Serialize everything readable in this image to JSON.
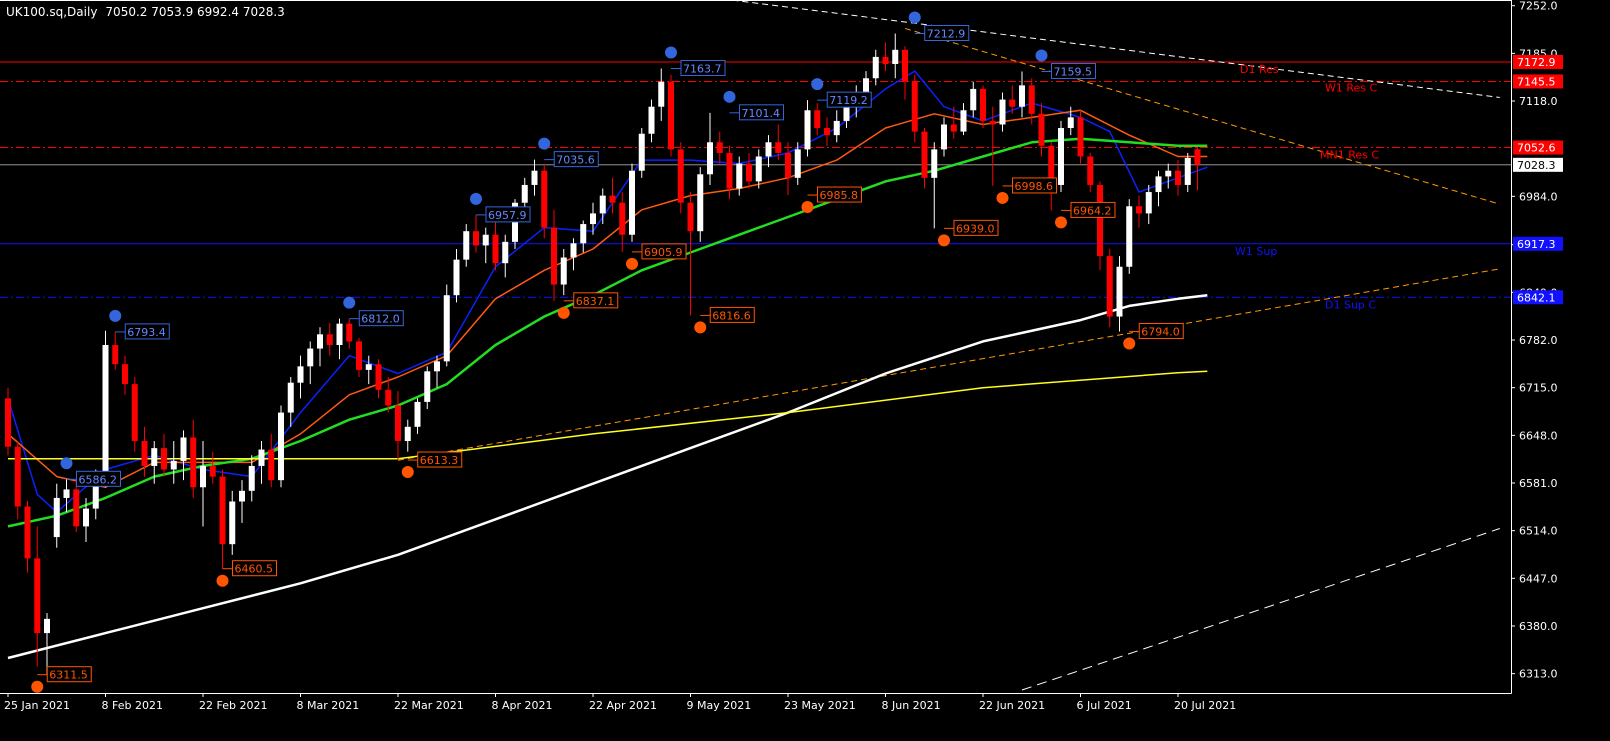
{
  "header": {
    "symbol_tf": "UK100.sq,Daily",
    "ohlc": "7050.2 7053.9 6992.4 7028.3"
  },
  "colors": {
    "background": "#000000",
    "axis": "#ffffff",
    "bull": "#ffffff",
    "bear": "#ff0000",
    "ema_blue": "#0a22ff",
    "ema_orange": "#ff5a14",
    "ema_green": "#22dd22",
    "sma_white": "#ffffff",
    "sma_yellow": "#ffff22",
    "swing_high": "#3366dd",
    "swing_low": "#ff5500",
    "res_red": "#ff0000",
    "sup_blue": "#1111ff",
    "trend_orange": "#ff9900"
  },
  "chart_data": {
    "type": "candlestick",
    "title": "UK100.sq,Daily",
    "ylim": [
      6290,
      7260
    ],
    "y_ticks": [
      7252.0,
      7185.0,
      7118.0,
      6984.0,
      6916.0,
      6849.0,
      6782.0,
      6715.0,
      6648.0,
      6581.0,
      6514.0,
      6447.0,
      6380.0,
      6313.0
    ],
    "x_labels": [
      "25 Jan 2021",
      "8 Feb 2021",
      "22 Feb 2021",
      "8 Mar 2021",
      "22 Mar 2021",
      "8 Apr 2021",
      "22 Apr 2021",
      "9 May 2021",
      "23 May 2021",
      "8 Jun 2021",
      "22 Jun 2021",
      "6 Jul 2021",
      "20 Jul 2021"
    ],
    "x_label_index": [
      0,
      10,
      20,
      30,
      40,
      50,
      60,
      70,
      80,
      90,
      100,
      110,
      120
    ],
    "last_price": 7028.3,
    "price_tags": [
      {
        "value": 7172.9,
        "color": "#ff0000"
      },
      {
        "value": 7145.5,
        "color": "#ff0000"
      },
      {
        "value": 7052.6,
        "color": "#ff0000"
      },
      {
        "value": 6917.3,
        "color": "#1111ff"
      },
      {
        "value": 6842.1,
        "color": "#1111ff"
      }
    ],
    "levels": [
      {
        "name": "D1 Res",
        "value": 7172.9,
        "style": "solid",
        "color": "#ff0000"
      },
      {
        "name": "W1 Res C",
        "value": 7145.5,
        "style": "dashdot",
        "color": "#ff0000"
      },
      {
        "name": "MN1 Res C",
        "value": 7052.6,
        "style": "dashdot",
        "color": "#ff0000"
      },
      {
        "name": "W1 Sup",
        "value": 6917.3,
        "style": "solid",
        "color": "#1111ff"
      },
      {
        "name": "D1 Sup C",
        "value": 6842.1,
        "style": "dashdot",
        "color": "#1111ff"
      }
    ],
    "level_labels": [
      {
        "text": "D1 Res",
        "value": 7172.9
      },
      {
        "text": "W1 Res C",
        "value": 7145.5
      },
      {
        "text": "MN1 Res C",
        "value": 7052.6
      },
      {
        "text": "W1 Sup",
        "value": 6917.3
      },
      {
        "text": "D1 Sup C",
        "value": 6842.1
      }
    ],
    "swing_highs": [
      {
        "i": 11,
        "value": 6793.4,
        "text": "6793.4"
      },
      {
        "i": 6,
        "value": 6586.2,
        "text": "6586.2"
      },
      {
        "i": 35,
        "value": 6812.0,
        "text": "6812.0"
      },
      {
        "i": 48,
        "value": 6957.9,
        "text": "6957.9"
      },
      {
        "i": 55,
        "value": 7035.6,
        "text": "7035.6"
      },
      {
        "i": 68,
        "value": 7163.7,
        "text": "7163.7"
      },
      {
        "i": 74,
        "value": 7101.4,
        "text": "7101.4"
      },
      {
        "i": 83,
        "value": 7119.2,
        "text": "7119.2"
      },
      {
        "i": 93,
        "value": 7212.9,
        "text": "7212.9"
      },
      {
        "i": 106,
        "value": 7159.5,
        "text": "7159.5"
      }
    ],
    "swing_lows": [
      {
        "i": 3,
        "value": 6311.5,
        "text": "6311.5"
      },
      {
        "i": 22,
        "value": 6460.5,
        "text": "6460.5"
      },
      {
        "i": 41,
        "value": 6613.3,
        "text": "6613.3"
      },
      {
        "i": 57,
        "value": 6837.1,
        "text": "6837.1"
      },
      {
        "i": 64,
        "value": 6905.9,
        "text": "6905.9"
      },
      {
        "i": 71,
        "value": 6816.6,
        "text": "6816.6"
      },
      {
        "i": 82,
        "value": 6985.8,
        "text": "6985.8"
      },
      {
        "i": 96,
        "value": 6939.0,
        "text": "6939.0"
      },
      {
        "i": 102,
        "value": 6998.6,
        "text": "6998.6"
      },
      {
        "i": 108,
        "value": 6964.2,
        "text": "6964.2"
      },
      {
        "i": 115,
        "value": 6794.0,
        "text": "6794.0"
      }
    ],
    "trendlines": [
      {
        "color": "#ffffff",
        "dash": "6,4",
        "i1": 57,
        "v1": 7290,
        "i2": 153,
        "v2": 7123
      },
      {
        "color": "#ff9900",
        "dash": "6,4",
        "i1": 92,
        "v1": 7220,
        "i2": 153,
        "v2": 6973
      },
      {
        "color": "#ff9900",
        "dash": "6,4",
        "i1": 40,
        "v1": 6613,
        "i2": 153,
        "v2": 6882
      },
      {
        "color": "#ffffff",
        "dash": "10,6",
        "i1": 104,
        "v1": 6290,
        "i2": 153,
        "v2": 6517
      }
    ],
    "ohlc": [
      [
        6700,
        6715,
        6620,
        6632
      ],
      [
        6632,
        6640,
        6530,
        6548
      ],
      [
        6548,
        6556,
        6455,
        6475
      ],
      [
        6475,
        6520,
        6323,
        6370
      ],
      [
        6370,
        6398,
        6311.5,
        6390
      ],
      [
        6505,
        6580,
        6490,
        6560
      ],
      [
        6560,
        6586.2,
        6540,
        6572
      ],
      [
        6572,
        6585,
        6512,
        6520
      ],
      [
        6520,
        6560,
        6498,
        6545
      ],
      [
        6545,
        6600,
        6530,
        6585
      ],
      [
        6585,
        6795,
        6575,
        6775
      ],
      [
        6775,
        6793.4,
        6740,
        6748
      ],
      [
        6748,
        6760,
        6705,
        6720
      ],
      [
        6720,
        6730,
        6625,
        6640
      ],
      [
        6640,
        6660,
        6590,
        6605
      ],
      [
        6605,
        6640,
        6580,
        6630
      ],
      [
        6630,
        6650,
        6590,
        6600
      ],
      [
        6600,
        6640,
        6580,
        6612
      ],
      [
        6612,
        6655,
        6585,
        6645
      ],
      [
        6645,
        6670,
        6560,
        6575
      ],
      [
        6575,
        6640,
        6520,
        6605
      ],
      [
        6605,
        6625,
        6580,
        6590
      ],
      [
        6590,
        6600,
        6460.5,
        6495
      ],
      [
        6495,
        6570,
        6480,
        6555
      ],
      [
        6555,
        6585,
        6525,
        6570
      ],
      [
        6570,
        6620,
        6555,
        6605
      ],
      [
        6605,
        6640,
        6580,
        6628
      ],
      [
        6628,
        6650,
        6575,
        6585
      ],
      [
        6585,
        6690,
        6575,
        6680
      ],
      [
        6680,
        6730,
        6660,
        6722
      ],
      [
        6722,
        6760,
        6700,
        6745
      ],
      [
        6745,
        6780,
        6720,
        6770
      ],
      [
        6770,
        6800,
        6745,
        6790
      ],
      [
        6790,
        6806,
        6760,
        6775
      ],
      [
        6775,
        6812,
        6755,
        6805
      ],
      [
        6805,
        6812,
        6770,
        6780
      ],
      [
        6780,
        6785,
        6730,
        6740
      ],
      [
        6740,
        6760,
        6720,
        6748
      ],
      [
        6748,
        6755,
        6700,
        6712
      ],
      [
        6712,
        6730,
        6680,
        6690
      ],
      [
        6690,
        6710,
        6613.3,
        6640
      ],
      [
        6640,
        6670,
        6625,
        6660
      ],
      [
        6660,
        6700,
        6650,
        6695
      ],
      [
        6695,
        6745,
        6685,
        6738
      ],
      [
        6738,
        6760,
        6715,
        6752
      ],
      [
        6752,
        6860,
        6745,
        6845
      ],
      [
        6845,
        6910,
        6835,
        6895
      ],
      [
        6895,
        6945,
        6885,
        6935
      ],
      [
        6935,
        6957.9,
        6905,
        6915
      ],
      [
        6915,
        6940,
        6890,
        6930
      ],
      [
        6930,
        6950,
        6880,
        6890
      ],
      [
        6890,
        6930,
        6870,
        6920
      ],
      [
        6920,
        6980,
        6910,
        6975
      ],
      [
        6975,
        7010,
        6960,
        7000
      ],
      [
        7000,
        7035.6,
        6985,
        7020
      ],
      [
        7020,
        7030,
        6925,
        6940
      ],
      [
        6940,
        6965,
        6837.1,
        6860
      ],
      [
        6860,
        6910,
        6845,
        6898
      ],
      [
        6898,
        6925,
        6880,
        6918
      ],
      [
        6918,
        6950,
        6905,
        6945
      ],
      [
        6945,
        6975,
        6930,
        6960
      ],
      [
        6960,
        6995,
        6945,
        6985
      ],
      [
        6985,
        7010,
        6960,
        6975
      ],
      [
        6975,
        6990,
        6905.9,
        6930
      ],
      [
        6930,
        7030,
        6920,
        7020
      ],
      [
        7020,
        7080,
        7010,
        7072
      ],
      [
        7072,
        7120,
        7060,
        7110
      ],
      [
        7110,
        7163.7,
        7090,
        7145
      ],
      [
        7145,
        7155,
        7040,
        7050
      ],
      [
        7050,
        7060,
        6960,
        6975
      ],
      [
        6975,
        6990,
        6816.6,
        6935
      ],
      [
        6935,
        7025,
        6920,
        7015
      ],
      [
        7015,
        7101.4,
        7000,
        7060
      ],
      [
        7060,
        7075,
        7030,
        7045
      ],
      [
        7045,
        7055,
        6980,
        6995
      ],
      [
        6995,
        7040,
        6985,
        7030
      ],
      [
        7030,
        7045,
        6995,
        7005
      ],
      [
        7005,
        7050,
        6995,
        7040
      ],
      [
        7040,
        7070,
        7025,
        7060
      ],
      [
        7060,
        7085,
        7035,
        7045
      ],
      [
        7045,
        7060,
        6985.8,
        7010
      ],
      [
        7010,
        7060,
        7000,
        7050
      ],
      [
        7050,
        7119.2,
        7040,
        7105
      ],
      [
        7105,
        7115,
        7070,
        7080
      ],
      [
        7080,
        7095,
        7055,
        7070
      ],
      [
        7070,
        7105,
        7060,
        7090
      ],
      [
        7090,
        7120,
        7080,
        7110
      ],
      [
        7110,
        7140,
        7095,
        7130
      ],
      [
        7130,
        7160,
        7115,
        7150
      ],
      [
        7150,
        7190,
        7140,
        7180
      ],
      [
        7180,
        7200,
        7160,
        7170
      ],
      [
        7170,
        7212.9,
        7150,
        7190
      ],
      [
        7190,
        7195,
        7120,
        7145
      ],
      [
        7145,
        7155,
        7060,
        7075
      ],
      [
        7075,
        7080,
        6995,
        7010
      ],
      [
        7010,
        7060,
        6939,
        7050
      ],
      [
        7050,
        7095,
        7040,
        7085
      ],
      [
        7085,
        7110,
        7065,
        7075
      ],
      [
        7075,
        7115,
        7070,
        7105
      ],
      [
        7105,
        7145,
        7095,
        7135
      ],
      [
        7135,
        7140,
        7080,
        7090
      ],
      [
        7090,
        7110,
        6998.6,
        7085
      ],
      [
        7085,
        7130,
        7075,
        7120
      ],
      [
        7120,
        7140,
        7100,
        7110
      ],
      [
        7110,
        7159.5,
        7095,
        7140
      ],
      [
        7140,
        7150,
        7085,
        7100
      ],
      [
        7100,
        7115,
        7040,
        7055
      ],
      [
        7055,
        7060,
        6964.2,
        7000
      ],
      [
        7000,
        7090,
        6990,
        7080
      ],
      [
        7080,
        7110,
        7070,
        7095
      ],
      [
        7095,
        7105,
        7030,
        7040
      ],
      [
        7040,
        7045,
        6990,
        7000
      ],
      [
        7000,
        7005,
        6880,
        6900
      ],
      [
        6900,
        6910,
        6800,
        6815
      ],
      [
        6815,
        6900,
        6794,
        6885
      ],
      [
        6885,
        6980,
        6875,
        6970
      ],
      [
        6970,
        6985,
        6940,
        6960
      ],
      [
        6960,
        7000,
        6945,
        6990
      ],
      [
        6990,
        7020,
        6970,
        7012
      ],
      [
        7012,
        7030,
        6995,
        7020
      ],
      [
        7020,
        7035,
        6985,
        7000
      ],
      [
        7000,
        7045,
        6990,
        7038
      ],
      [
        7050.2,
        7053.9,
        6992.4,
        7028.3
      ]
    ],
    "series": [
      {
        "name": "EMA fast",
        "color": "#0a22ff",
        "width": 1.5
      },
      {
        "name": "EMA mid",
        "color": "#ff5a14",
        "width": 1.5
      },
      {
        "name": "EMA slow",
        "color": "#22dd22",
        "width": 2.5
      },
      {
        "name": "SMA long",
        "color": "#ffffff",
        "width": 2.5
      },
      {
        "name": "SMA base",
        "color": "#ffff22",
        "width": 1.5
      }
    ],
    "ma_points": {
      "EMA fast": [
        [
          0,
          6700
        ],
        [
          3,
          6565
        ],
        [
          5,
          6540
        ],
        [
          10,
          6600
        ],
        [
          15,
          6620
        ],
        [
          20,
          6600
        ],
        [
          25,
          6590
        ],
        [
          30,
          6680
        ],
        [
          35,
          6760
        ],
        [
          40,
          6735
        ],
        [
          45,
          6765
        ],
        [
          50,
          6885
        ],
        [
          55,
          6940
        ],
        [
          60,
          6935
        ],
        [
          65,
          7035
        ],
        [
          70,
          7035
        ],
        [
          75,
          7030
        ],
        [
          80,
          7045
        ],
        [
          85,
          7080
        ],
        [
          90,
          7135
        ],
        [
          93,
          7160
        ],
        [
          96,
          7110
        ],
        [
          100,
          7090
        ],
        [
          105,
          7115
        ],
        [
          110,
          7095
        ],
        [
          113,
          7075
        ],
        [
          116,
          6990
        ],
        [
          120,
          7010
        ],
        [
          123,
          7025
        ]
      ],
      "EMA mid": [
        [
          0,
          6650
        ],
        [
          5,
          6590
        ],
        [
          10,
          6575
        ],
        [
          15,
          6610
        ],
        [
          20,
          6610
        ],
        [
          25,
          6610
        ],
        [
          30,
          6650
        ],
        [
          35,
          6705
        ],
        [
          40,
          6730
        ],
        [
          45,
          6760
        ],
        [
          50,
          6840
        ],
        [
          55,
          6880
        ],
        [
          60,
          6910
        ],
        [
          65,
          6965
        ],
        [
          70,
          6985
        ],
        [
          75,
          6995
        ],
        [
          80,
          7010
        ],
        [
          85,
          7035
        ],
        [
          90,
          7080
        ],
        [
          95,
          7100
        ],
        [
          100,
          7085
        ],
        [
          105,
          7095
        ],
        [
          110,
          7105
        ],
        [
          115,
          7070
        ],
        [
          120,
          7040
        ],
        [
          123,
          7040
        ]
      ],
      "EMA slow": [
        [
          0,
          6520
        ],
        [
          5,
          6535
        ],
        [
          10,
          6560
        ],
        [
          15,
          6590
        ],
        [
          20,
          6605
        ],
        [
          25,
          6615
        ],
        [
          30,
          6640
        ],
        [
          35,
          6670
        ],
        [
          40,
          6690
        ],
        [
          45,
          6720
        ],
        [
          50,
          6775
        ],
        [
          55,
          6815
        ],
        [
          60,
          6845
        ],
        [
          65,
          6880
        ],
        [
          70,
          6905
        ],
        [
          75,
          6930
        ],
        [
          80,
          6955
        ],
        [
          85,
          6980
        ],
        [
          90,
          7005
        ],
        [
          95,
          7020
        ],
        [
          100,
          7040
        ],
        [
          105,
          7060
        ],
        [
          110,
          7065
        ],
        [
          115,
          7060
        ],
        [
          120,
          7055
        ],
        [
          123,
          7055
        ]
      ],
      "SMA long": [
        [
          0,
          6335
        ],
        [
          10,
          6370
        ],
        [
          20,
          6405
        ],
        [
          30,
          6440
        ],
        [
          40,
          6480
        ],
        [
          50,
          6530
        ],
        [
          60,
          6580
        ],
        [
          70,
          6630
        ],
        [
          80,
          6680
        ],
        [
          90,
          6735
        ],
        [
          100,
          6780
        ],
        [
          110,
          6810
        ],
        [
          115,
          6830
        ],
        [
          120,
          6840
        ],
        [
          123,
          6845
        ]
      ],
      "SMA base": [
        [
          0,
          6615
        ],
        [
          40,
          6615
        ],
        [
          60,
          6650
        ],
        [
          80,
          6680
        ],
        [
          100,
          6715
        ],
        [
          120,
          6736
        ],
        [
          123,
          6738
        ]
      ]
    }
  }
}
